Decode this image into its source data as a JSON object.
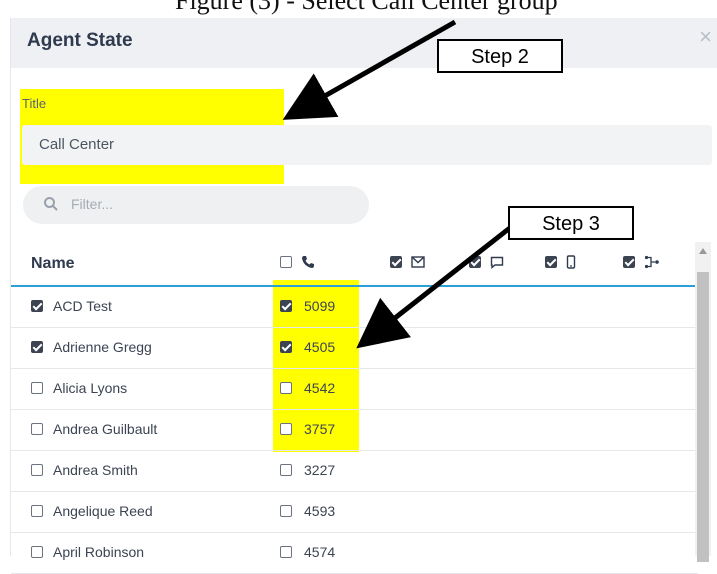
{
  "dialog": {
    "title": "Agent State",
    "close_label": "×"
  },
  "form": {
    "title_label": "Title",
    "title_value": "Call Center"
  },
  "filter": {
    "placeholder": "Filter..."
  },
  "table": {
    "name_header": "Name",
    "column_icons": [
      {
        "icon": "phone-icon",
        "checked": false
      },
      {
        "icon": "email-icon",
        "checked": true
      },
      {
        "icon": "chat-icon",
        "checked": true
      },
      {
        "icon": "mobile-icon",
        "checked": true
      },
      {
        "icon": "workflow-icon",
        "checked": true
      }
    ],
    "rows": [
      {
        "name": "ACD Test",
        "checked": true,
        "ext": "5099",
        "ext_checked": true
      },
      {
        "name": "Adrienne Gregg",
        "checked": true,
        "ext": "4505",
        "ext_checked": true
      },
      {
        "name": "Alicia Lyons",
        "checked": false,
        "ext": "4542",
        "ext_checked": false
      },
      {
        "name": "Andrea Guilbault",
        "checked": false,
        "ext": "3757",
        "ext_checked": false
      },
      {
        "name": "Andrea Smith",
        "checked": false,
        "ext": "3227",
        "ext_checked": false
      },
      {
        "name": "Angelique Reed",
        "checked": false,
        "ext": "4593",
        "ext_checked": false
      },
      {
        "name": "April Robinson",
        "checked": false,
        "ext": "4574",
        "ext_checked": false
      }
    ]
  },
  "annotations": {
    "step2": "Step 2",
    "step3": "Step 3"
  },
  "colors": {
    "highlight": "#ffff00",
    "accent": "#2d9fd8",
    "header_bg": "#eef0f3"
  }
}
